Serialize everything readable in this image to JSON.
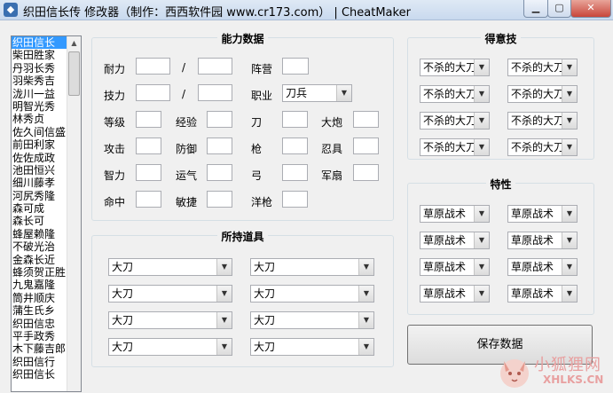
{
  "window": {
    "title": "织田信长传 修改器（制作：西西软件园 www.cr173.com） | CheatMaker"
  },
  "list": {
    "items": [
      "织田信长",
      "柴田胜家",
      "丹羽长秀",
      "羽柴秀吉",
      "泷川一益",
      "明智光秀",
      "林秀贞",
      "佐久间信盛",
      "前田利家",
      "佐佐成政",
      "池田恒兴",
      "细川藤孝",
      "河尻秀隆",
      "森可成",
      "森长可",
      "蜂屋赖隆",
      "不破光治",
      "金森长近",
      "蜂须贺正胜",
      "九鬼嘉隆",
      "筒井顺庆",
      "蒲生氏乡",
      "织田信忠",
      "平手政秀",
      "木下藤吉郎",
      "织田信行",
      "织田信长"
    ],
    "selected_index": 0
  },
  "abilities": {
    "title": "能力数据",
    "hp_label": "耐力",
    "slash": "/",
    "skill_label": "技力",
    "camp_label": "阵营",
    "job_label": "职业",
    "job_value": "刀兵",
    "level_label": "等级",
    "exp_label": "经验",
    "sword_label": "刀",
    "cannon_label": "大炮",
    "attack_label": "攻击",
    "defense_label": "防御",
    "spear_label": "枪",
    "ninja_label": "忍具",
    "int_label": "智力",
    "luck_label": "运气",
    "bow_label": "弓",
    "fan_label": "军扇",
    "hit_label": "命中",
    "agility_label": "敏捷",
    "musket_label": "洋枪"
  },
  "special_skills": {
    "title": "得意技",
    "values": [
      "不杀的大刀",
      "不杀的大刀",
      "不杀的大刀",
      "不杀的大刀",
      "不杀的大刀",
      "不杀的大刀",
      "不杀的大刀",
      "不杀的大刀"
    ]
  },
  "traits": {
    "title": "特性",
    "values": [
      "草原战术",
      "草原战术",
      "草原战术",
      "草原战术",
      "草原战术",
      "草原战术",
      "草原战术",
      "草原战术"
    ]
  },
  "items": {
    "title": "所持道具",
    "values": [
      "大刀",
      "大刀",
      "大刀",
      "大刀",
      "大刀",
      "大刀",
      "大刀",
      "大刀"
    ]
  },
  "save_label": "保存数据",
  "watermark": {
    "cn": "小狐狸网",
    "en": "XHLKS.CN"
  },
  "colors": {
    "selection": "#3399ff",
    "titlebar": "#c9d9ee",
    "close": "#c8463a"
  }
}
